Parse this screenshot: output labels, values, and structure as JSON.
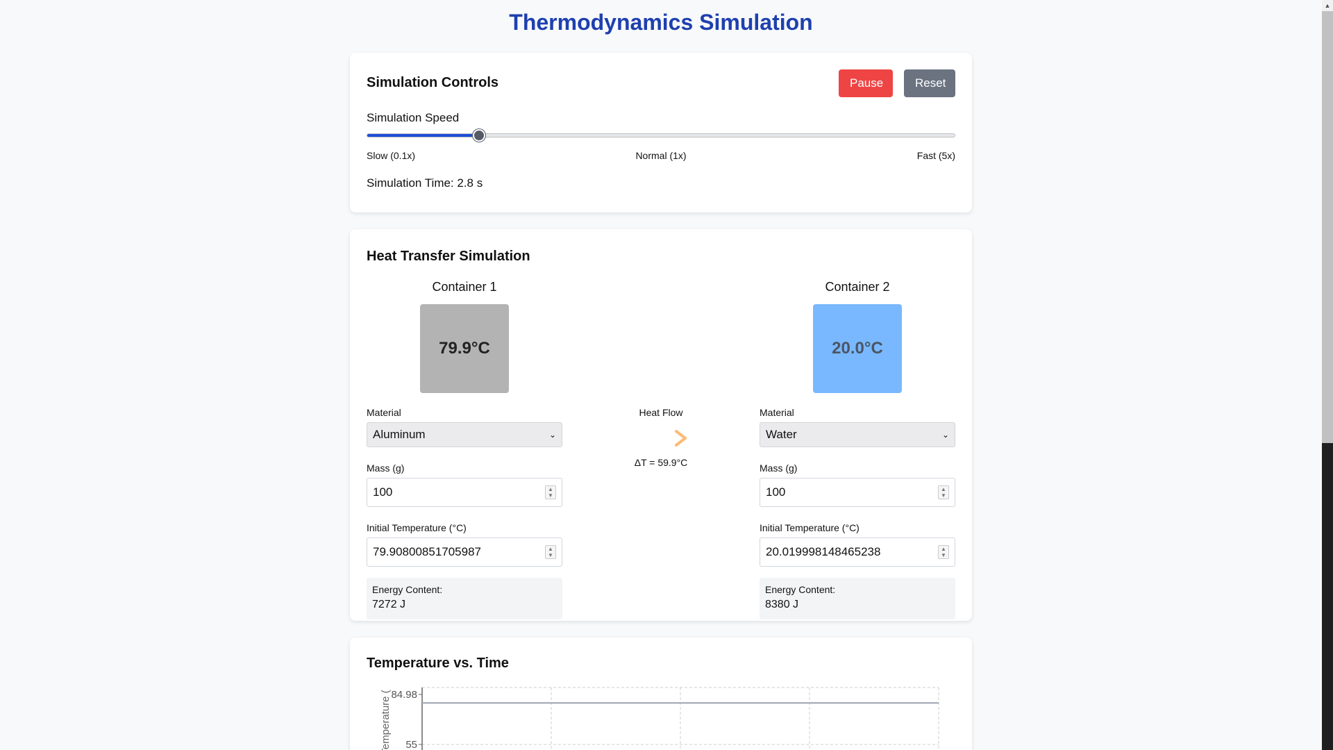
{
  "page": {
    "title": "Thermodynamics Simulation"
  },
  "controls": {
    "title": "Simulation Controls",
    "pause_label": "Pause",
    "reset_label": "Reset",
    "pause_color": "#ef4444",
    "reset_color": "#6b7280",
    "speed_label": "Simulation Speed",
    "speed_fraction": 0.19,
    "tick_slow": "Slow (0.1x)",
    "tick_normal": "Normal (1x)",
    "tick_fast": "Fast (5x)",
    "time_text": "Simulation Time: 2.8 s"
  },
  "heat": {
    "title": "Heat Transfer Simulation",
    "container1": {
      "title": "Container 1",
      "temp_display": "79.9°C",
      "box_color": "#b3b3b3",
      "text_color": "#222222",
      "material_label": "Material",
      "material": "Aluminum",
      "mass_label": "Mass (g)",
      "mass": "100",
      "initial_temp_label": "Initial Temperature (°C)",
      "initial_temp": "79.90800851705987",
      "energy_label": "Energy Content:",
      "energy": "7272 J"
    },
    "container2": {
      "title": "Container 2",
      "temp_display": "20.0°C",
      "box_color": "#79b8ff",
      "text_color": "#4b5563",
      "material_label": "Material",
      "material": "Water",
      "mass_label": "Mass (g)",
      "mass": "100",
      "initial_temp_label": "Initial Temperature (°C)",
      "initial_temp": "20.019998148465238",
      "energy_label": "Energy Content:",
      "energy": "8380 J"
    },
    "flow_label": "Heat Flow",
    "delta_t": "ΔT = 59.9°C"
  },
  "chart": {
    "title": "Temperature vs. Time"
  },
  "chart_data": {
    "type": "line",
    "title": "Temperature vs. Time",
    "xlabel": "",
    "ylabel": "Temperature (",
    "yticks": [
      84.98,
      55
    ],
    "ylim": [
      55,
      84.98
    ],
    "grid": true,
    "series": [
      {
        "x": [
          0,
          2.8
        ],
        "values": [
          79.9,
          79.9
        ],
        "color": "#9ca3af"
      }
    ]
  }
}
